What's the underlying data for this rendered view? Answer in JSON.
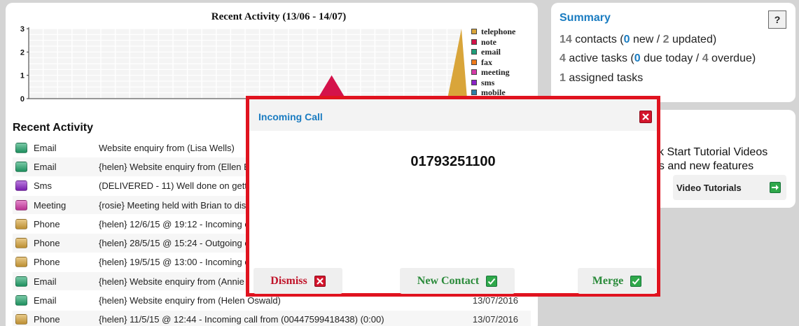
{
  "chart_data": {
    "type": "area",
    "title": "Recent Activity (13/06 - 14/07)",
    "ylim": [
      0,
      3
    ],
    "yticks": [
      "0",
      "1",
      "2",
      "3"
    ],
    "grid": true,
    "legend_placement": "right",
    "series": [
      {
        "name": "telephone",
        "color": "#d9a53a"
      },
      {
        "name": "note",
        "color": "#d4124a"
      },
      {
        "name": "email",
        "color": "#1f9e7a"
      },
      {
        "name": "fax",
        "color": "#ef7a1a"
      },
      {
        "name": "meeting",
        "color": "#d43aa8"
      },
      {
        "name": "sms",
        "color": "#8a22c8"
      },
      {
        "name": "mobile",
        "color": "#2e7fa8"
      }
    ],
    "peaks": [
      {
        "series": "note",
        "value": 1,
        "position_fraction": 0.7
      },
      {
        "series": "telephone",
        "value": 3,
        "position_fraction": 1.0
      }
    ]
  },
  "activity": {
    "heading": "Recent Activity",
    "rows": [
      {
        "type": "Email",
        "color": "#22a56c",
        "desc": "Website enquiry from (Lisa Wells)",
        "date": ""
      },
      {
        "type": "Email",
        "color": "#22a56c",
        "desc": "{helen} Website enquiry from (Ellen B",
        "date": ""
      },
      {
        "type": "Sms",
        "color": "#8a22c8",
        "desc": "(DELIVERED - 11) Well done on gett",
        "date": ""
      },
      {
        "type": "Meeting",
        "color": "#d43aa8",
        "desc": "{rosie} Meeting held with Brian to dis",
        "date": ""
      },
      {
        "type": "Phone",
        "color": "#d9a53a",
        "desc": "{helen} 12/6/15 @ 19:12 - Incoming c",
        "date": ""
      },
      {
        "type": "Phone",
        "color": "#d9a53a",
        "desc": "{helen} 28/5/15 @ 15:24 - Outgoing c",
        "date": ""
      },
      {
        "type": "Phone",
        "color": "#d9a53a",
        "desc": "{helen} 19/5/15 @ 13:00 - Incoming c",
        "date": ""
      },
      {
        "type": "Email",
        "color": "#22a56c",
        "desc": "{helen} Website enquiry from (Annie",
        "date": ""
      },
      {
        "type": "Email",
        "color": "#22a56c",
        "desc": "{helen} Website enquiry from (Helen Oswald)",
        "date": "13/07/2016"
      },
      {
        "type": "Phone",
        "color": "#d9a53a",
        "desc": "{helen} 11/5/15 @ 12:44 - Incoming call from (00447599418438) (0:00)",
        "date": "13/07/2016"
      }
    ]
  },
  "summary": {
    "title": "Summary",
    "help_label": "?",
    "contacts_count": "14",
    "contacts_text": " contacts (",
    "new_count": "0",
    "new_text": " new / ",
    "updated_count": "2",
    "updated_text": " updated)",
    "tasks_count": "4",
    "tasks_text": " active tasks (",
    "due_count": "0",
    "due_text": " due today / ",
    "overdue_count": "4",
    "overdue_text": " overdue)",
    "assigned_count": "1",
    "assigned_text": " assigned tasks"
  },
  "tutorial": {
    "line1": "ck Start Tutorial Videos",
    "line2": "os and new features",
    "button_label": "Video Tutorials"
  },
  "modal": {
    "title": "Incoming Call",
    "number": "01793251100",
    "dismiss_label": "Dismiss",
    "new_contact_label": "New Contact",
    "merge_label": "Merge"
  }
}
